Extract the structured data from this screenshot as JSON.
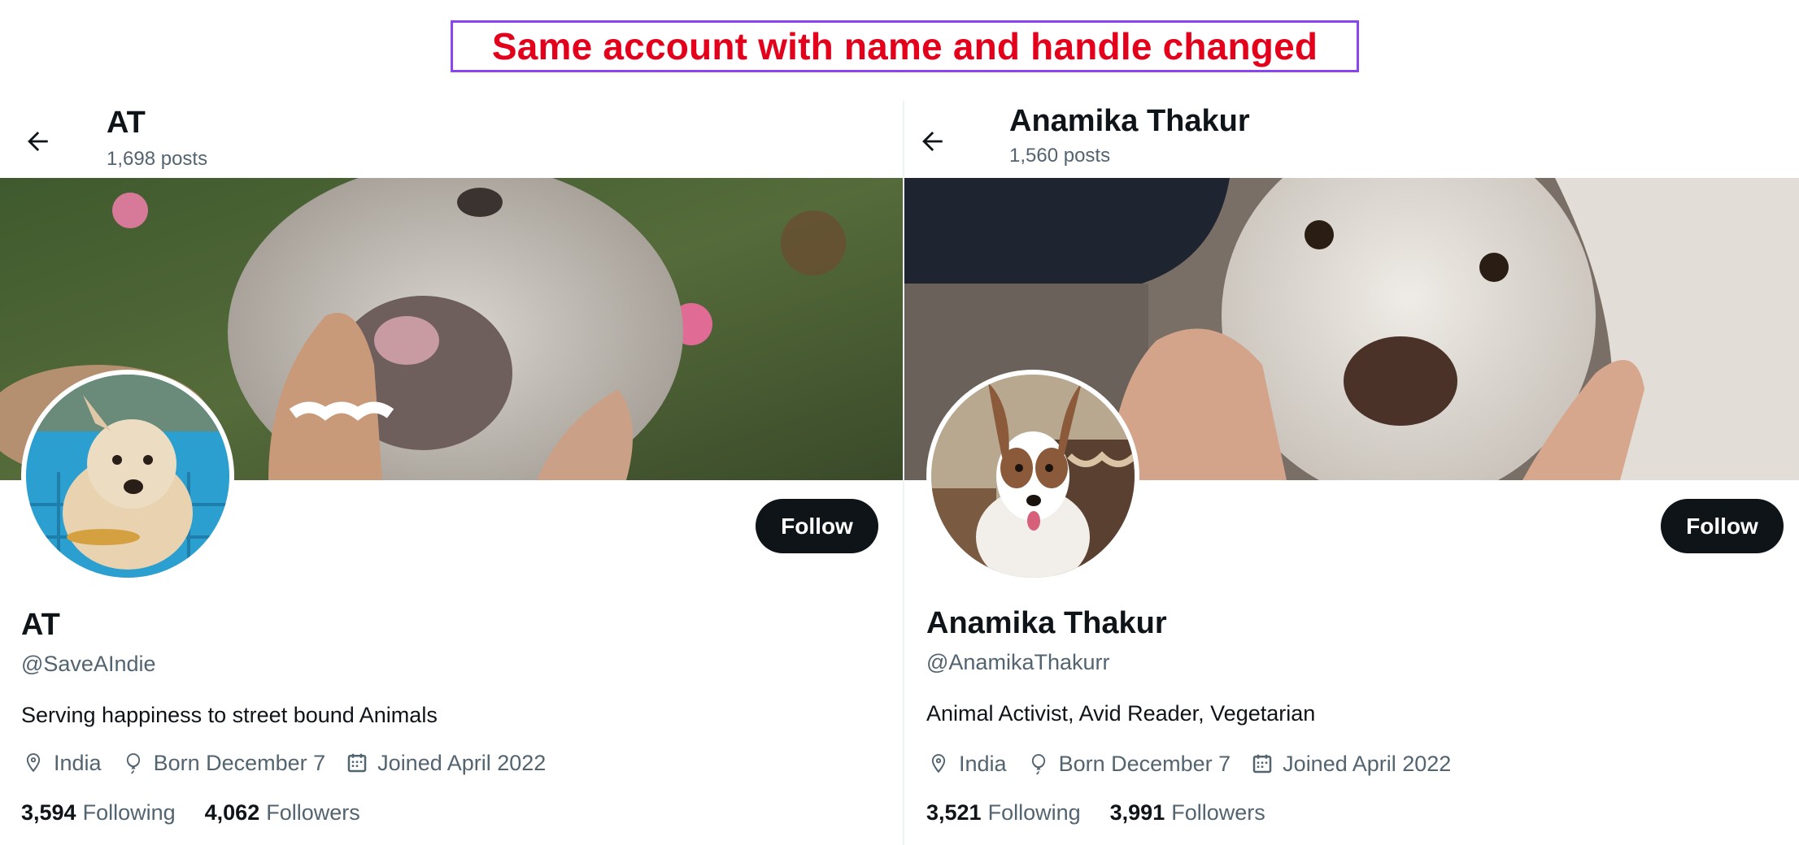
{
  "caption": "Same account with name and handle changed",
  "profiles": [
    {
      "top_name": "AT",
      "posts": "1,698 posts",
      "display_name": "AT",
      "handle": "@SaveAIndie",
      "bio": "Serving happiness to street bound Animals",
      "location": "India",
      "birthday": "Born December 7",
      "joined": "Joined April 2022",
      "following_count": "3,594",
      "following_label": "Following",
      "followers_count": "4,062",
      "followers_label": "Followers",
      "follow_label": "Follow",
      "banner_desc_icon": "dog-banner-photo",
      "avatar_icon": "dog-avatar-photo"
    },
    {
      "top_name": "Anamika Thakur",
      "posts": "1,560 posts",
      "display_name": "Anamika Thakur",
      "handle": "@AnamikaThakurr",
      "bio": "Animal Activist, Avid Reader, Vegetarian",
      "location": "India",
      "birthday": "Born December 7",
      "joined": "Joined April 2022",
      "following_count": "3,521",
      "following_label": "Following",
      "followers_count": "3,991",
      "followers_label": "Followers",
      "follow_label": "Follow",
      "banner_desc_icon": "dog-banner-photo",
      "avatar_icon": "dog-avatar-photo"
    }
  ],
  "colors": {
    "caption_text": "#e4001b",
    "caption_border": "#8b45f0",
    "follow_bg": "#0f1419",
    "secondary_text": "#536471"
  }
}
